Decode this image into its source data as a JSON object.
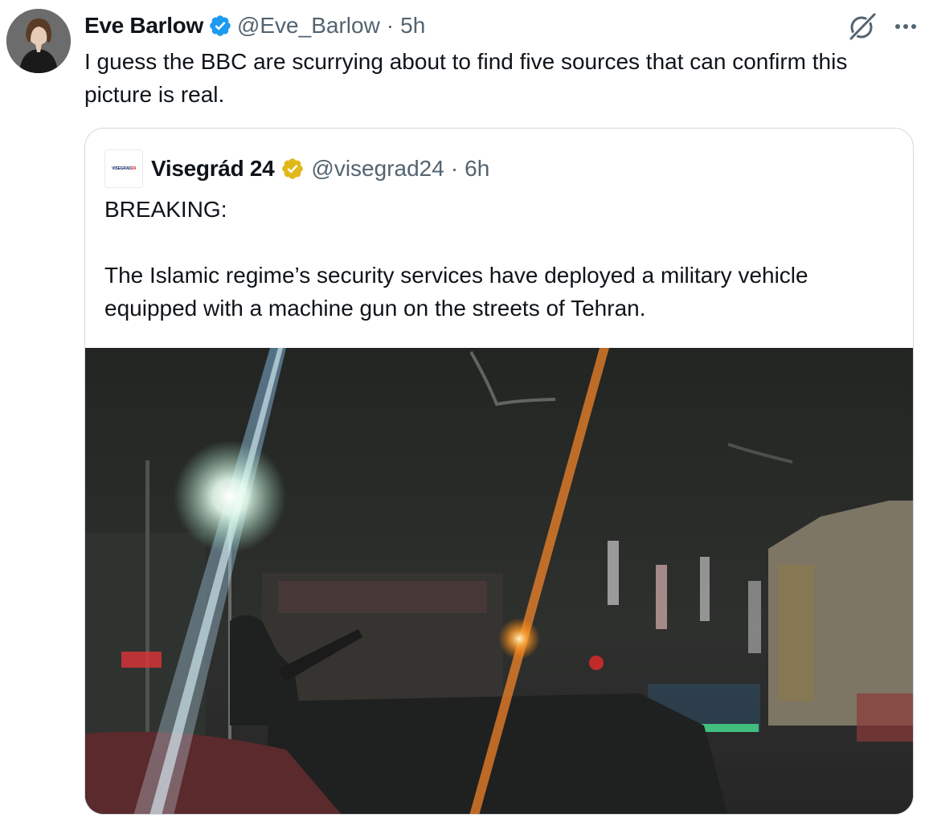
{
  "tweet": {
    "author_name": "Eve Barlow",
    "author_handle": "@Eve_Barlow",
    "separator": "·",
    "time": "5h",
    "verified_badge": "blue-verified-icon",
    "text": "I guess the BBC are scurrying about to find five sources that can confirm this picture is real.",
    "action_icons": [
      "grok-icon",
      "more-icon"
    ]
  },
  "quoted_tweet": {
    "author_name": "Visegrád 24",
    "author_handle": "@visegrad24",
    "separator": "·",
    "time": "6h",
    "avatar_logo_text": "VISEGRAD24",
    "verified_badge": "gold-verified-icon",
    "text_line_1": "BREAKING:",
    "text_line_2": "The Islamic regime’s security services have deployed a military vehicle equipped with a machine gun on the streets of Tehran.",
    "media": {
      "type": "photo",
      "description_icon": "night-street-photo"
    }
  },
  "colors": {
    "text_primary": "#0f1419",
    "text_secondary": "#536471",
    "verified_blue": "#1d9bf0",
    "verified_gold": "#e2b719",
    "border": "#cfd9de"
  }
}
